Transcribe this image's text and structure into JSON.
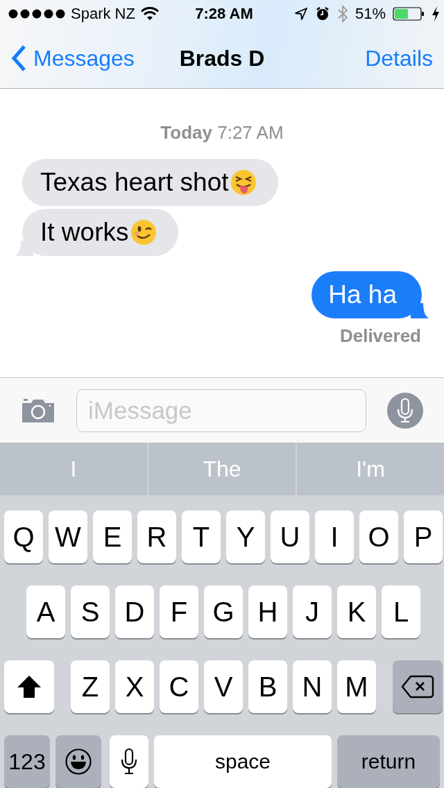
{
  "status_bar": {
    "carrier": "Spark NZ",
    "time": "7:28 AM",
    "battery": "51%"
  },
  "nav": {
    "back": "Messages",
    "title": "Brads D",
    "action": "Details"
  },
  "timestamp": {
    "day": "Today",
    "time": "7:27 AM"
  },
  "messages": [
    {
      "kind": "incoming",
      "text": "Texas heart shot",
      "emoji": true,
      "tail": false
    },
    {
      "kind": "incoming",
      "text": "It works",
      "emoji": true,
      "tail": true
    },
    {
      "kind": "outgoing",
      "text": "Ha ha",
      "tail": true
    }
  ],
  "status_note": "Delivered",
  "composer": {
    "placeholder": "iMessage"
  },
  "suggestions": [
    "I",
    "The",
    "I'm"
  ],
  "keyboard": [
    [
      {
        "kind": "letter",
        "label": "Q"
      },
      {
        "kind": "letter",
        "label": "W"
      },
      {
        "kind": "letter",
        "label": "E"
      },
      {
        "kind": "letter",
        "label": "R"
      },
      {
        "kind": "letter",
        "label": "T"
      },
      {
        "kind": "letter",
        "label": "Y"
      },
      {
        "kind": "letter",
        "label": "U"
      },
      {
        "kind": "letter",
        "label": "I"
      },
      {
        "kind": "letter",
        "label": "O"
      },
      {
        "kind": "letter",
        "label": "P"
      }
    ],
    [
      {
        "kind": "letter",
        "label": "A"
      },
      {
        "kind": "letter",
        "label": "S"
      },
      {
        "kind": "letter",
        "label": "D"
      },
      {
        "kind": "letter",
        "label": "F"
      },
      {
        "kind": "letter",
        "label": "G"
      },
      {
        "kind": "letter",
        "label": "H"
      },
      {
        "kind": "letter",
        "label": "J"
      },
      {
        "kind": "letter",
        "label": "K"
      },
      {
        "kind": "letter",
        "label": "L"
      }
    ],
    [
      {
        "kind": "shift"
      },
      {
        "kind": "letter",
        "label": "Z"
      },
      {
        "kind": "letter",
        "label": "X"
      },
      {
        "kind": "letter",
        "label": "C"
      },
      {
        "kind": "letter",
        "label": "V"
      },
      {
        "kind": "letter",
        "label": "B"
      },
      {
        "kind": "letter",
        "label": "N"
      },
      {
        "kind": "letter",
        "label": "M"
      },
      {
        "kind": "delete"
      }
    ],
    [
      {
        "kind": "numbers",
        "label": "123"
      },
      {
        "kind": "emoji"
      },
      {
        "kind": "dictation"
      },
      {
        "kind": "space",
        "label": "space"
      },
      {
        "kind": "return",
        "label": "return"
      }
    ]
  ]
}
